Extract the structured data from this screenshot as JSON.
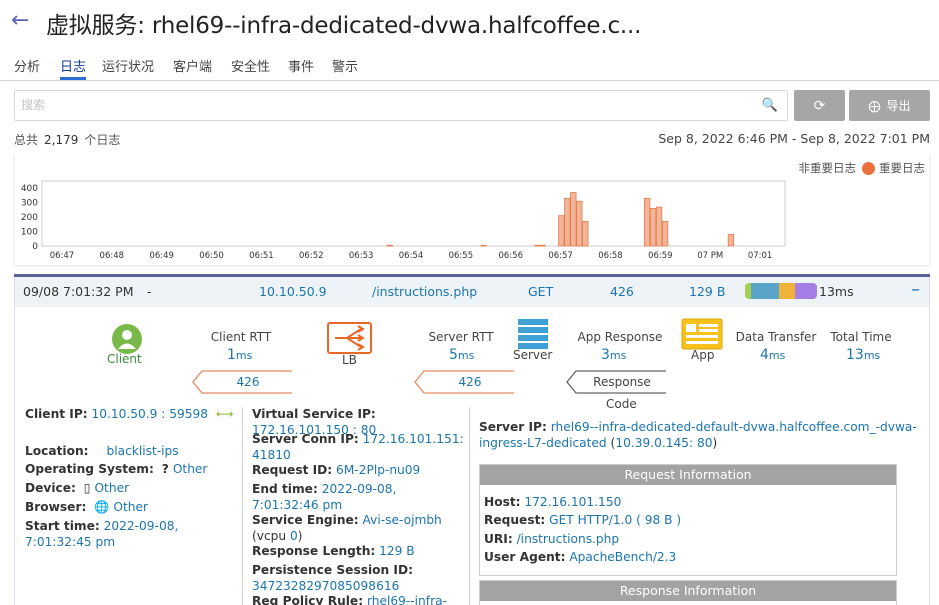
{
  "header": {
    "title": "虚拟服务: rhel69--infra-dedicated-dvwa.halfcoffee.c..."
  },
  "tabs": [
    "分析",
    "日志",
    "运行状况",
    "客户端",
    "安全性",
    "事件",
    "警示"
  ],
  "search": {
    "placeholder": "搜索"
  },
  "toolbar": {
    "export_label": "导出"
  },
  "summary": {
    "prefix": "总共",
    "count": "2,179",
    "suffix": "个日志"
  },
  "date_range": "Sep 8, 2022 6:46 PM - Sep 8, 2022 7:01 PM",
  "legend": {
    "non_significant": "非重要日志",
    "significant": "重要日志"
  },
  "chart_data": {
    "type": "bar",
    "y_ticks": [
      0,
      100,
      200,
      300,
      400
    ],
    "ylim": [
      0,
      450
    ],
    "x_ticks": [
      "06:47",
      "06:48",
      "06:49",
      "06:50",
      "06:51",
      "06:52",
      "06:53",
      "06:54",
      "06:55",
      "06:56",
      "06:57",
      "06:58",
      "06:59",
      "07 PM",
      "07:01"
    ],
    "x_start_min": 46.6,
    "x_end_min": 61.5,
    "bar_color": "#f3b497",
    "bars": [
      {
        "t": 53.52,
        "v": 5
      },
      {
        "t": 55.4,
        "v": 4
      },
      {
        "t": 56.48,
        "v": 5
      },
      {
        "t": 56.58,
        "v": 5
      },
      {
        "t": 56.96,
        "v": 210
      },
      {
        "t": 57.08,
        "v": 330
      },
      {
        "t": 57.2,
        "v": 370
      },
      {
        "t": 57.32,
        "v": 310
      },
      {
        "t": 57.44,
        "v": 170
      },
      {
        "t": 58.68,
        "v": 330
      },
      {
        "t": 58.8,
        "v": 260
      },
      {
        "t": 58.92,
        "v": 270
      },
      {
        "t": 59.04,
        "v": 170
      },
      {
        "t": 60.36,
        "v": 80
      }
    ]
  },
  "log_row": {
    "time": "09/08 7:01:32 PM",
    "dash": "-",
    "client_ip": "10.10.50.9",
    "uri": "/instructions.php",
    "method": "GET",
    "status": "426",
    "size": "129 B",
    "duration": "13ms",
    "timing_colors": [
      "#a6cf52",
      "#5aa3c9",
      "#f0b33a",
      "#a57ee6"
    ]
  },
  "flow": {
    "client": "Client",
    "lb": "LB",
    "server": "Server",
    "app": "App",
    "client_rtt_label": "Client RTT",
    "client_rtt_value": "1",
    "client_rtt_unit": "ms",
    "server_rtt_label": "Server RTT",
    "server_rtt_value": "5",
    "server_rtt_unit": "ms",
    "app_response_label": "App Response",
    "app_response_value": "3",
    "app_response_unit": "ms",
    "data_transfer_label": "Data Transfer",
    "data_transfer_value": "4",
    "data_transfer_unit": "ms",
    "total_time_label": "Total Time",
    "total_time_value": "13",
    "total_time_unit": "ms",
    "lb_code": "426",
    "server_code": "426",
    "response_label": "Response",
    "code_label": "Code"
  },
  "client_info": {
    "ip_label": "Client IP:",
    "ip_value": "10.10.50.9 : 59598",
    "location_label": "Location:",
    "location_value": "blacklist-ips",
    "os_label": "Operating System:",
    "os_value": "Other",
    "device_label": "Device:",
    "device_value": "Other",
    "browser_label": "Browser:",
    "browser_value": "Other",
    "start_label": "Start time:",
    "start_value": "2022-09-08, 7:01:32:45 pm"
  },
  "vs_info": {
    "vip_label": "Virtual Service IP:",
    "vip_value": "172.16.101.150 : 80",
    "conn_label": "Server Conn IP:",
    "conn_value": "172.16.101.151: 41810",
    "reqid_label": "Request ID:",
    "reqid_value": "6M-2Plp-nu09",
    "end_label": "End time:",
    "end_value": "2022-09-08, 7:01:32:46 pm",
    "se_label": "Service Engine:",
    "se_value": "Avi-se-ojmbh",
    "se_vcpu_prefix": "(vcpu ",
    "se_vcpu": "0",
    "se_vcpu_suffix": ")",
    "resp_len_label": "Response Length:",
    "resp_len_value": "129 B",
    "persist_label": "Persistence Session ID:",
    "persist_value": "3472328297085098616",
    "policy_label": "Req Policy Rule:",
    "policy_value": "rhel69--infra-"
  },
  "server_info": {
    "label": "Server IP:",
    "value": "rhel69--infra-dedicated-default-dvwa.halfcoffee.com_-dvwa-ingress-L7-dedicated",
    "addr": "10.39.0.145: 80",
    "addr_prefix": "(",
    "addr_suffix": ")"
  },
  "request_info": {
    "header": "Request Information",
    "host_label": "Host:",
    "host_value": "172.16.101.150",
    "request_label": "Request:",
    "request_value": "GET HTTP/1.0 ( 98 B )",
    "uri_label": "URI:",
    "uri_value": "/instructions.php",
    "ua_label": "User Agent:",
    "ua_value": "ApacheBench/2.3"
  },
  "response_info": {
    "header": "Response Information"
  },
  "icons": [
    "back-arrow-icon",
    "search-icon",
    "refresh-icon",
    "export-icon",
    "client-icon",
    "lb-icon",
    "server-icon",
    "app-icon",
    "os-unknown-icon",
    "device-icon",
    "browser-globe-icon",
    "collapse-icon"
  ]
}
